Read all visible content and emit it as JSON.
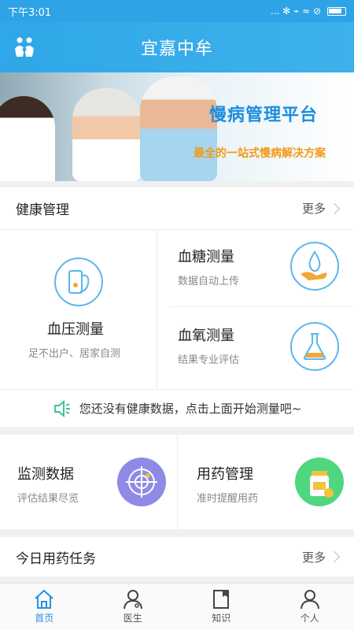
{
  "status_bar": {
    "time": "下午3:01",
    "icons": "... ✻ ⌁ ≈ ⊘"
  },
  "app_bar": {
    "title": "宜嘉中牟"
  },
  "banner": {
    "title": "慢病管理平台",
    "subtitle": "最全的一站式慢病解决方案"
  },
  "health": {
    "title": "健康管理",
    "more": "更多",
    "cards": [
      {
        "title": "血压测量",
        "sub": "足不出户、居家自测"
      },
      {
        "title": "血糖测量",
        "sub": "数据自动上传"
      },
      {
        "title": "血氧测量",
        "sub": "结果专业评估"
      }
    ]
  },
  "tip": {
    "text": "您还没有健康数据，点击上面开始测量吧~"
  },
  "tools": [
    {
      "title": "监测数据",
      "sub": "评估结果尽览"
    },
    {
      "title": "用药管理",
      "sub": "准时提醒用药"
    }
  ],
  "today": {
    "title": "今日用药任务",
    "more": "更多"
  },
  "tabs": [
    {
      "label": "首页",
      "active": true
    },
    {
      "label": "医生",
      "active": false
    },
    {
      "label": "知识",
      "active": false
    },
    {
      "label": "个人",
      "active": false
    }
  ],
  "colors": {
    "primary": "#2fa7e8",
    "accent_orange": "#f19a16",
    "purple": "#8f8ae6",
    "green": "#4fd67f"
  }
}
